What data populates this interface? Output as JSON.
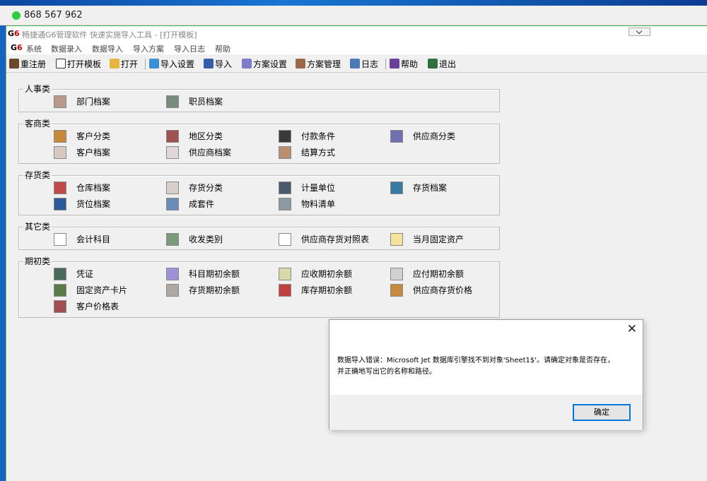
{
  "remote": {
    "id": "868 567 962"
  },
  "window": {
    "title": "畅捷通G6管理软件 快速实施导入工具 - [打开模板]"
  },
  "menu": [
    "系统",
    "数据录入",
    "数据导入",
    "导入方案",
    "导入日志",
    "帮助"
  ],
  "toolbar": [
    "重注册",
    "打开模板",
    "打开",
    "导入设置",
    "导入",
    "方案设置",
    "方案管理",
    "日志",
    "帮助",
    "退出"
  ],
  "groups": [
    {
      "title": "人事类",
      "items": [
        "部门档案",
        "职员档案"
      ]
    },
    {
      "title": "客商类",
      "items": [
        "客户分类",
        "地区分类",
        "付款条件",
        "供应商分类",
        "客户档案",
        "供应商档案",
        "结算方式"
      ]
    },
    {
      "title": "存货类",
      "items": [
        "仓库档案",
        "存货分类",
        "计量单位",
        "存货档案",
        "货位档案",
        "成套件",
        "物料清单"
      ]
    },
    {
      "title": "其它类",
      "items": [
        "会计科目",
        "收发类别",
        "供应商存货对照表",
        "当月固定资产"
      ]
    },
    {
      "title": "期初类",
      "items": [
        "凭证",
        "科目期初余额",
        "应收期初余额",
        "应付期初余额",
        "固定资产卡片",
        "存货期初余额",
        "库存期初余额",
        "供应商存货价格",
        "客户价格表"
      ]
    }
  ],
  "dialog": {
    "message_line1": "数据导入错误：Microsoft Jet 数据库引擎找不到对象'Sheet1$'。请确定对象是否存在，",
    "message_line2": "并正确地写出它的名称和路径。",
    "ok_label": "确定"
  }
}
